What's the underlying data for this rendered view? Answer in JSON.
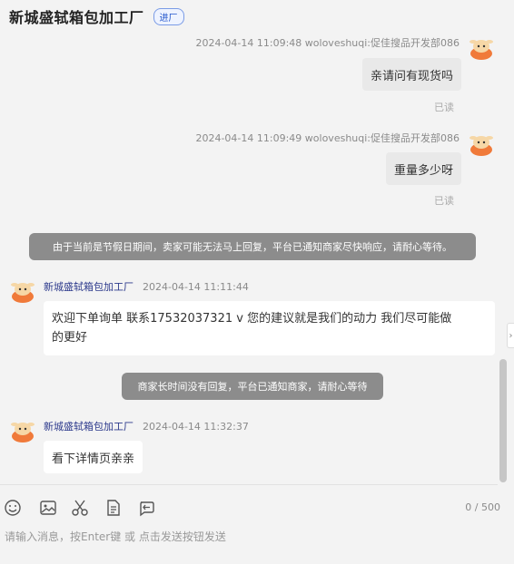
{
  "header": {
    "title": "新城盛轼箱包加工厂",
    "badge": "进厂"
  },
  "messages": [
    {
      "meta": "2024-04-14 11:09:48  woloveshuqi:促佳搜品开发部086",
      "text": "亲请问有现货吗",
      "status": "已读"
    },
    {
      "meta": "2024-04-14 11:09:49  woloveshuqi:促佳搜品开发部086",
      "text": "重量多少呀",
      "status": "已读"
    }
  ],
  "notices": {
    "holiday": "由于当前是节假日期间，卖家可能无法马上回复，平台已通知商家尽快响应，请耐心等待。",
    "no_reply": "商家长时间没有回复，平台已通知商家，请耐心等待"
  },
  "seller_messages": [
    {
      "name": "新城盛轼箱包加工厂",
      "time": "2024-04-14 11:11:44",
      "line1": "欢迎下单询单 联系17532037321   v   您的建议就是我们的动力   我们尽可能做",
      "line2": "的更好"
    },
    {
      "name": "新城盛轼箱包加工厂",
      "time": "2024-04-14 11:32:37",
      "text": "看下详情页亲亲"
    }
  ],
  "toolbar": {
    "icons": [
      "emoji-icon",
      "image-icon",
      "scissors-icon",
      "document-icon",
      "history-icon"
    ],
    "counter": "0 / 500"
  },
  "input": {
    "placeholder": "请输入消息，按Enter键 或 点击发送按钮发送",
    "value": ""
  },
  "colors": {
    "background": "#f3f3f3",
    "notice_bg": "#8c8c8c",
    "badge_blue": "#2255cc",
    "sender_name": "#2d3a8c"
  }
}
